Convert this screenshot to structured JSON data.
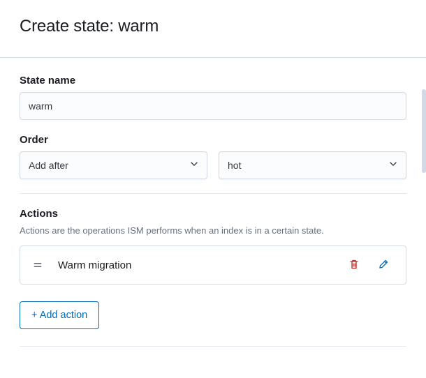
{
  "header": {
    "title": "Create state: warm"
  },
  "stateName": {
    "label": "State name",
    "value": "warm"
  },
  "order": {
    "label": "Order",
    "position": {
      "value": "Add after"
    },
    "reference": {
      "value": "hot"
    }
  },
  "actions": {
    "label": "Actions",
    "help": "Actions are the operations ISM performs when an index is in a certain state.",
    "items": [
      {
        "name": "Warm migration"
      }
    ],
    "addButton": "+ Add action"
  }
}
